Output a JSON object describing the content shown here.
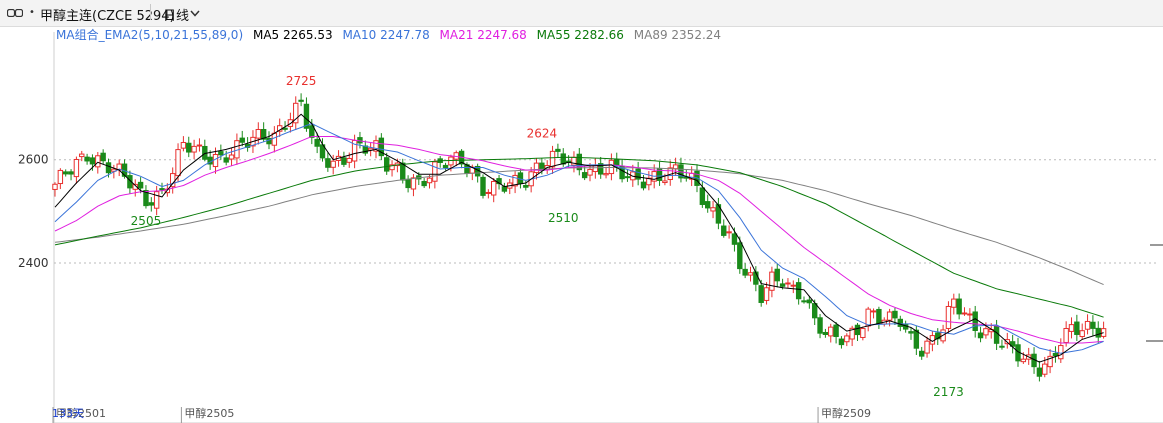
{
  "header": {
    "dot": "•",
    "title": "甲醇主连(CZCE 5294)",
    "period": "日线"
  },
  "legend": {
    "group_label": "MA组合_EMA2(5,10,21,55,89,0)",
    "items": [
      {
        "label": "MA5 2265.53",
        "color": "#000000"
      },
      {
        "label": "MA10 2247.78",
        "color": "#3b74d9"
      },
      {
        "label": "MA21 2247.68",
        "color": "#e020e0"
      },
      {
        "label": "MA55 2282.66",
        "color": "#0a7a0a"
      },
      {
        "label": "MA89 2352.24",
        "color": "#808080"
      }
    ]
  },
  "colors": {
    "up": "#e8302e",
    "down": "#1a8a1a",
    "grid": "#bbbbbb"
  },
  "chart_data": {
    "type": "candlestick",
    "ylim": [
      2150,
      2770
    ],
    "yticks": [
      2400,
      2600
    ],
    "xtick_labels": [
      {
        "text": "甲醇2501",
        "at": 0
      },
      {
        "text": "甲醇2505",
        "at": 24
      },
      {
        "text": "甲醇2509",
        "at": 143
      }
    ],
    "footer_note": "133天",
    "price_labels": [
      {
        "text": "2725",
        "at": 46,
        "value": 2725,
        "pos": "above",
        "color": "#e8302e"
      },
      {
        "text": "2505",
        "at": 17,
        "value": 2505,
        "pos": "below",
        "color": "#1a8a1a"
      },
      {
        "text": "2624",
        "at": 91,
        "value": 2624,
        "pos": "above",
        "color": "#e8302e"
      },
      {
        "text": "2510",
        "at": 95,
        "value": 2510,
        "pos": "below",
        "color": "#1a8a1a"
      },
      {
        "text": "2173",
        "at": 167,
        "value": 2173,
        "pos": "below",
        "color": "#1a8a1a"
      }
    ],
    "anchors": {
      "close": [
        [
          0,
          2545
        ],
        [
          4,
          2595
        ],
        [
          6,
          2615
        ],
        [
          9,
          2595
        ],
        [
          12,
          2570
        ],
        [
          15,
          2545
        ],
        [
          17,
          2525
        ],
        [
          20,
          2540
        ],
        [
          22,
          2575
        ],
        [
          24,
          2625
        ],
        [
          28,
          2610
        ],
        [
          31,
          2608
        ],
        [
          35,
          2625
        ],
        [
          38,
          2640
        ],
        [
          41,
          2650
        ],
        [
          44,
          2690
        ],
        [
          46,
          2705
        ],
        [
          47,
          2668
        ],
        [
          49,
          2605
        ],
        [
          52,
          2595
        ],
        [
          54,
          2608
        ],
        [
          56,
          2630
        ],
        [
          58,
          2622
        ],
        [
          60,
          2615
        ],
        [
          62,
          2588
        ],
        [
          64,
          2585
        ],
        [
          66,
          2565
        ],
        [
          68,
          2558
        ],
        [
          70,
          2565
        ],
        [
          72,
          2585
        ],
        [
          74,
          2600
        ],
        [
          76,
          2602
        ],
        [
          78,
          2585
        ],
        [
          80,
          2545
        ],
        [
          82,
          2540
        ],
        [
          84,
          2545
        ],
        [
          86,
          2553
        ],
        [
          88,
          2565
        ],
        [
          90,
          2590
        ],
        [
          92,
          2600
        ],
        [
          94,
          2605
        ],
        [
          96,
          2590
        ],
        [
          98,
          2580
        ],
        [
          100,
          2582
        ],
        [
          102,
          2588
        ],
        [
          104,
          2590
        ],
        [
          106,
          2570
        ],
        [
          108,
          2555
        ],
        [
          110,
          2558
        ],
        [
          112,
          2570
        ],
        [
          114,
          2578
        ],
        [
          116,
          2582
        ],
        [
          118,
          2565
        ],
        [
          120,
          2540
        ],
        [
          122,
          2505
        ],
        [
          124,
          2488
        ],
        [
          126,
          2460
        ],
        [
          128,
          2400
        ],
        [
          130,
          2362
        ],
        [
          132,
          2330
        ],
        [
          134,
          2368
        ],
        [
          136,
          2375
        ],
        [
          138,
          2352
        ],
        [
          140,
          2335
        ],
        [
          142,
          2280
        ],
        [
          144,
          2258
        ],
        [
          146,
          2258
        ],
        [
          148,
          2262
        ],
        [
          150,
          2275
        ],
        [
          152,
          2300
        ],
        [
          154,
          2288
        ],
        [
          156,
          2285
        ],
        [
          158,
          2292
        ],
        [
          160,
          2258
        ],
        [
          162,
          2238
        ],
        [
          164,
          2248
        ],
        [
          166,
          2270
        ],
        [
          168,
          2320
        ],
        [
          170,
          2305
        ],
        [
          172,
          2280
        ],
        [
          174,
          2272
        ],
        [
          176,
          2252
        ],
        [
          178,
          2232
        ],
        [
          180,
          2218
        ],
        [
          182,
          2210
        ],
        [
          184,
          2202
        ],
        [
          186,
          2212
        ],
        [
          188,
          2248
        ],
        [
          190,
          2265
        ],
        [
          192,
          2268
        ],
        [
          194,
          2275
        ],
        [
          196,
          2278
        ]
      ],
      "ma5": [
        [
          0,
          2508
        ],
        [
          4,
          2555
        ],
        [
          8,
          2595
        ],
        [
          12,
          2580
        ],
        [
          16,
          2540
        ],
        [
          20,
          2528
        ],
        [
          24,
          2580
        ],
        [
          28,
          2612
        ],
        [
          32,
          2620
        ],
        [
          36,
          2632
        ],
        [
          40,
          2645
        ],
        [
          44,
          2670
        ],
        [
          46,
          2688
        ],
        [
          48,
          2670
        ],
        [
          50,
          2630
        ],
        [
          52,
          2600
        ],
        [
          56,
          2612
        ],
        [
          60,
          2620
        ],
        [
          64,
          2598
        ],
        [
          68,
          2572
        ],
        [
          72,
          2572
        ],
        [
          76,
          2595
        ],
        [
          80,
          2575
        ],
        [
          84,
          2548
        ],
        [
          88,
          2555
        ],
        [
          92,
          2585
        ],
        [
          96,
          2595
        ],
        [
          100,
          2588
        ],
        [
          104,
          2590
        ],
        [
          108,
          2568
        ],
        [
          112,
          2562
        ],
        [
          116,
          2575
        ],
        [
          120,
          2560
        ],
        [
          124,
          2512
        ],
        [
          128,
          2445
        ],
        [
          132,
          2360
        ],
        [
          136,
          2352
        ],
        [
          140,
          2348
        ],
        [
          144,
          2298
        ],
        [
          148,
          2268
        ],
        [
          152,
          2278
        ],
        [
          156,
          2288
        ],
        [
          160,
          2275
        ],
        [
          164,
          2248
        ],
        [
          168,
          2272
        ],
        [
          172,
          2292
        ],
        [
          176,
          2265
        ],
        [
          180,
          2228
        ],
        [
          184,
          2208
        ],
        [
          188,
          2222
        ],
        [
          192,
          2252
        ],
        [
          196,
          2265
        ]
      ],
      "ma10": [
        [
          0,
          2480
        ],
        [
          4,
          2518
        ],
        [
          8,
          2560
        ],
        [
          12,
          2582
        ],
        [
          16,
          2568
        ],
        [
          20,
          2548
        ],
        [
          24,
          2560
        ],
        [
          28,
          2590
        ],
        [
          32,
          2612
        ],
        [
          36,
          2625
        ],
        [
          40,
          2638
        ],
        [
          44,
          2655
        ],
        [
          48,
          2670
        ],
        [
          52,
          2650
        ],
        [
          56,
          2630
        ],
        [
          60,
          2622
        ],
        [
          64,
          2615
        ],
        [
          68,
          2598
        ],
        [
          72,
          2582
        ],
        [
          76,
          2585
        ],
        [
          80,
          2585
        ],
        [
          84,
          2570
        ],
        [
          88,
          2560
        ],
        [
          92,
          2570
        ],
        [
          96,
          2588
        ],
        [
          100,
          2590
        ],
        [
          104,
          2590
        ],
        [
          108,
          2578
        ],
        [
          112,
          2568
        ],
        [
          116,
          2570
        ],
        [
          120,
          2565
        ],
        [
          124,
          2540
        ],
        [
          128,
          2488
        ],
        [
          132,
          2425
        ],
        [
          136,
          2390
        ],
        [
          140,
          2370
        ],
        [
          144,
          2335
        ],
        [
          148,
          2298
        ],
        [
          152,
          2280
        ],
        [
          156,
          2282
        ],
        [
          160,
          2282
        ],
        [
          164,
          2268
        ],
        [
          168,
          2262
        ],
        [
          172,
          2278
        ],
        [
          176,
          2280
        ],
        [
          180,
          2258
        ],
        [
          184,
          2235
        ],
        [
          188,
          2225
        ],
        [
          192,
          2232
        ],
        [
          196,
          2248
        ]
      ],
      "ma21": [
        [
          0,
          2462
        ],
        [
          4,
          2482
        ],
        [
          8,
          2510
        ],
        [
          12,
          2530
        ],
        [
          16,
          2538
        ],
        [
          20,
          2540
        ],
        [
          24,
          2550
        ],
        [
          28,
          2570
        ],
        [
          32,
          2585
        ],
        [
          36,
          2598
        ],
        [
          40,
          2612
        ],
        [
          44,
          2628
        ],
        [
          48,
          2645
        ],
        [
          52,
          2645
        ],
        [
          56,
          2638
        ],
        [
          60,
          2632
        ],
        [
          64,
          2628
        ],
        [
          68,
          2620
        ],
        [
          72,
          2610
        ],
        [
          76,
          2605
        ],
        [
          80,
          2598
        ],
        [
          84,
          2588
        ],
        [
          88,
          2580
        ],
        [
          92,
          2580
        ],
        [
          96,
          2585
        ],
        [
          100,
          2588
        ],
        [
          104,
          2590
        ],
        [
          108,
          2586
        ],
        [
          112,
          2580
        ],
        [
          116,
          2578
        ],
        [
          120,
          2572
        ],
        [
          124,
          2560
        ],
        [
          128,
          2535
        ],
        [
          132,
          2500
        ],
        [
          136,
          2465
        ],
        [
          140,
          2430
        ],
        [
          144,
          2400
        ],
        [
          148,
          2370
        ],
        [
          152,
          2340
        ],
        [
          156,
          2318
        ],
        [
          160,
          2302
        ],
        [
          164,
          2290
        ],
        [
          168,
          2285
        ],
        [
          172,
          2282
        ],
        [
          176,
          2278
        ],
        [
          180,
          2268
        ],
        [
          184,
          2255
        ],
        [
          188,
          2245
        ],
        [
          192,
          2245
        ],
        [
          196,
          2248
        ]
      ],
      "ma55": [
        [
          0,
          2435
        ],
        [
          8,
          2452
        ],
        [
          16,
          2468
        ],
        [
          24,
          2488
        ],
        [
          32,
          2510
        ],
        [
          40,
          2535
        ],
        [
          48,
          2560
        ],
        [
          56,
          2578
        ],
        [
          64,
          2590
        ],
        [
          72,
          2598
        ],
        [
          80,
          2600
        ],
        [
          88,
          2602
        ],
        [
          96,
          2605
        ],
        [
          104,
          2602
        ],
        [
          112,
          2598
        ],
        [
          120,
          2590
        ],
        [
          128,
          2575
        ],
        [
          136,
          2548
        ],
        [
          144,
          2515
        ],
        [
          152,
          2470
        ],
        [
          160,
          2425
        ],
        [
          168,
          2380
        ],
        [
          176,
          2350
        ],
        [
          184,
          2330
        ],
        [
          190,
          2315
        ],
        [
          196,
          2295
        ]
      ],
      "ma89": [
        [
          0,
          2440
        ],
        [
          8,
          2450
        ],
        [
          16,
          2462
        ],
        [
          24,
          2475
        ],
        [
          32,
          2492
        ],
        [
          40,
          2510
        ],
        [
          48,
          2532
        ],
        [
          56,
          2548
        ],
        [
          64,
          2560
        ],
        [
          72,
          2570
        ],
        [
          80,
          2575
        ],
        [
          88,
          2580
        ],
        [
          96,
          2584
        ],
        [
          104,
          2585
        ],
        [
          112,
          2584
        ],
        [
          120,
          2580
        ],
        [
          128,
          2573
        ],
        [
          136,
          2560
        ],
        [
          144,
          2540
        ],
        [
          152,
          2515
        ],
        [
          160,
          2492
        ],
        [
          168,
          2465
        ],
        [
          176,
          2440
        ],
        [
          184,
          2410
        ],
        [
          190,
          2385
        ],
        [
          196,
          2358
        ]
      ]
    }
  }
}
